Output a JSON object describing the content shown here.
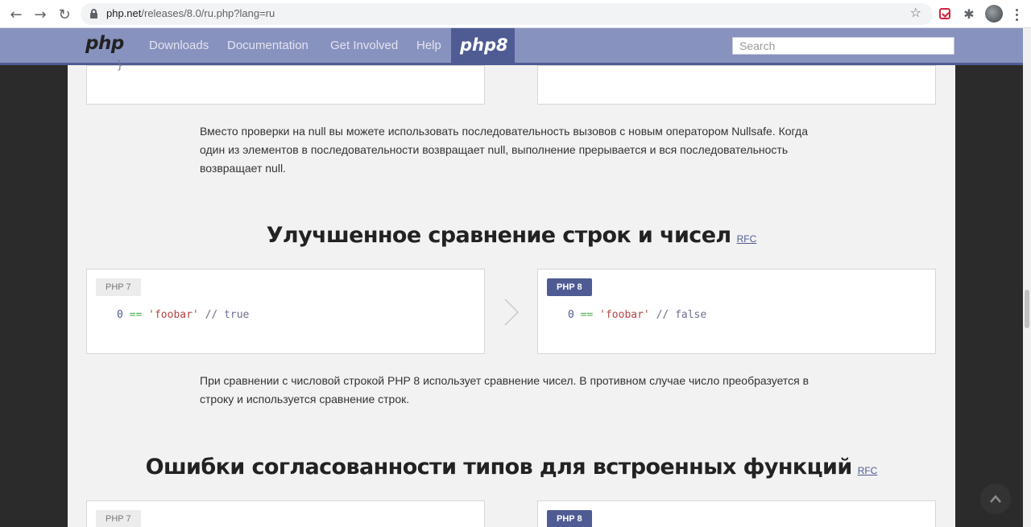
{
  "browser": {
    "url_host": "php.net",
    "url_path": "/releases/8.0/ru.php?lang=ru"
  },
  "nav": {
    "logo": "php",
    "links": [
      "Downloads",
      "Documentation",
      "Get Involved",
      "Help"
    ],
    "php8_logo": "php8",
    "search_placeholder": "Search"
  },
  "colors": {
    "nav_bg": "#8892bf",
    "nav_accent": "#4f5b93",
    "page_bg": "#f2f2f2"
  },
  "top_snippet": "}",
  "nullsafe_text": "Вместо проверки на null вы можете использовать последовательность вызовов с новым оператором Nullsafe. Когда один из элементов в последовательности возвращает null, выполнение прерывается и вся последовательность возвращает null.",
  "sections": [
    {
      "title": "Улучшенное сравнение строк и чисел",
      "rfc": "RFC",
      "php7": {
        "badge": "PHP 7",
        "code": {
          "num": "0",
          "op": "==",
          "str": "'foobar'",
          "comment": "// true"
        }
      },
      "php8": {
        "badge": "PHP 8",
        "code": {
          "num": "0",
          "op": "==",
          "str": "'foobar'",
          "comment": "// false"
        }
      },
      "description": "При сравнении с числовой строкой PHP 8 использует сравнение чисел. В противном случае число преобразуется в строку и используется сравнение строк."
    },
    {
      "title": "Ошибки согласованности типов для встроенных функций",
      "rfc": "RFC",
      "php7": {
        "badge": "PHP 7"
      },
      "php8": {
        "badge": "PHP 8"
      }
    }
  ]
}
